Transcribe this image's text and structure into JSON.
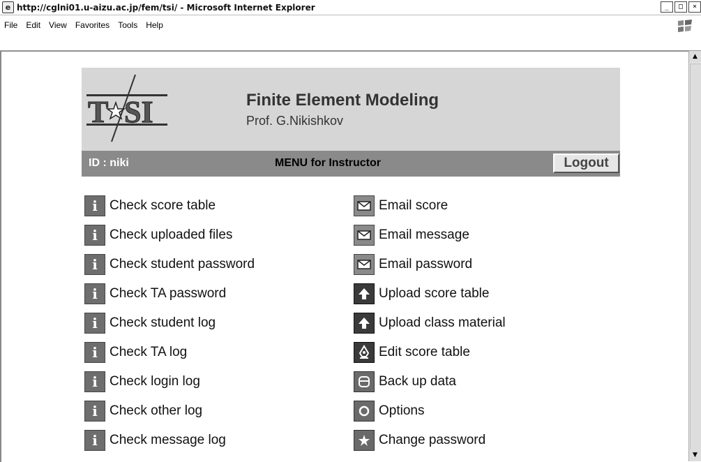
{
  "window": {
    "title": "http://cglni01.u-aizu.ac.jp/fem/tsi/ - Microsoft Internet Explorer",
    "min": "_",
    "max": "□",
    "close": "×"
  },
  "menubar": {
    "items": [
      {
        "label": "File"
      },
      {
        "label": "Edit"
      },
      {
        "label": "View"
      },
      {
        "label": "Favorites"
      },
      {
        "label": "Tools"
      },
      {
        "label": "Help"
      }
    ]
  },
  "header": {
    "logo_text": "TSI",
    "title": "Finite Element Modeling",
    "subtitle": "Prof. G.Nikishkov"
  },
  "bar": {
    "id_text": "ID : niki",
    "menu_text": "MENU for Instructor",
    "logout_label": "Logout"
  },
  "left_links": [
    {
      "label": "Check score table",
      "icon": "info-icon"
    },
    {
      "label": "Check uploaded files",
      "icon": "info-icon"
    },
    {
      "label": "Check student password",
      "icon": "info-icon"
    },
    {
      "label": "Check TA password",
      "icon": "info-icon"
    },
    {
      "label": "Check student log",
      "icon": "info-icon"
    },
    {
      "label": "Check TA log",
      "icon": "info-icon"
    },
    {
      "label": "Check login log",
      "icon": "info-icon"
    },
    {
      "label": "Check other log",
      "icon": "info-icon"
    },
    {
      "label": "Check message log",
      "icon": "info-icon"
    }
  ],
  "right_links": [
    {
      "label": "Email score",
      "icon": "envelope-icon"
    },
    {
      "label": "Email message",
      "icon": "envelope-icon"
    },
    {
      "label": "Email password",
      "icon": "envelope-icon"
    },
    {
      "label": "Upload score table",
      "icon": "upload-arrow-icon"
    },
    {
      "label": "Upload class material",
      "icon": "upload-arrow-icon"
    },
    {
      "label": "Edit score table",
      "icon": "pen-nib-icon"
    },
    {
      "label": "Back up data",
      "icon": "database-icon"
    },
    {
      "label": "Options",
      "icon": "circle-options-icon"
    },
    {
      "label": "Change password",
      "icon": "star-icon"
    }
  ]
}
